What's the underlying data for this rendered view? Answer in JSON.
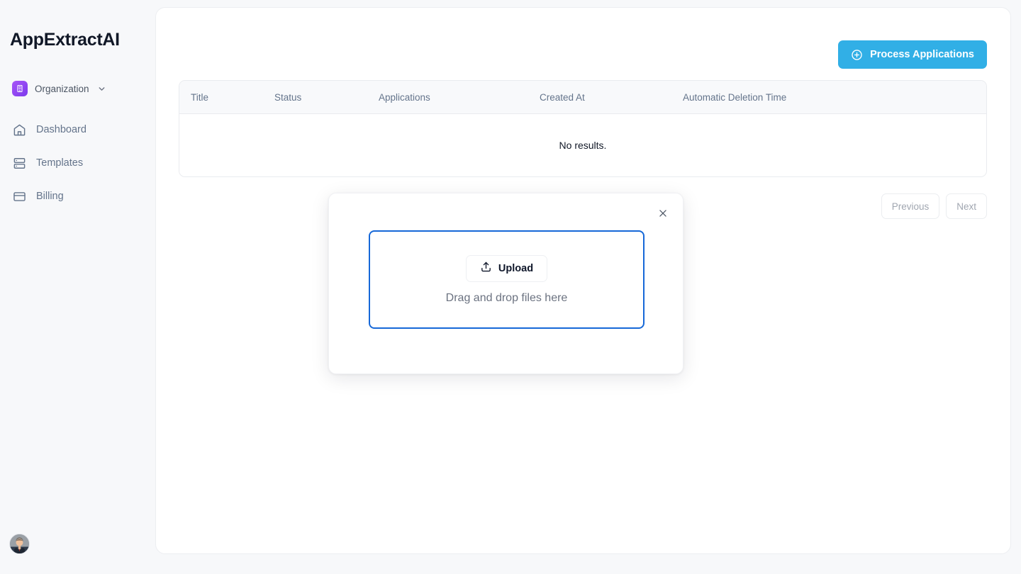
{
  "brand": {
    "name": "AppExtractAI"
  },
  "sidebar": {
    "org": {
      "label": "Organization",
      "logo_icon": "building-icon",
      "chevron_icon": "chevron-down-icon",
      "logo_gradient_from": "#a855f7",
      "logo_gradient_to": "#7c3aed"
    },
    "items": [
      {
        "label": "Dashboard",
        "icon": "home-icon"
      },
      {
        "label": "Templates",
        "icon": "server-stack-icon"
      },
      {
        "label": "Billing",
        "icon": "credit-card-icon"
      }
    ],
    "avatar": {
      "icon": "user-avatar-photo"
    },
    "background": "#f7f8fa"
  },
  "toolbar": {
    "process_label": "Process Applications",
    "process_icon": "circle-plus-icon",
    "accent": "#31afe6"
  },
  "table": {
    "columns": [
      "Title",
      "Status",
      "Applications",
      "Created At",
      "Automatic Deletion Time"
    ],
    "rows": [],
    "empty_message": "No results.",
    "header_background": "#f8f9fb"
  },
  "pagination": {
    "previous_label": "Previous",
    "next_label": "Next"
  },
  "modal": {
    "close_icon": "close-icon",
    "dropzone": {
      "upload_label": "Upload",
      "upload_icon": "upload-icon",
      "hint": "Drag and drop files here",
      "border_color": "#1668d8"
    }
  }
}
